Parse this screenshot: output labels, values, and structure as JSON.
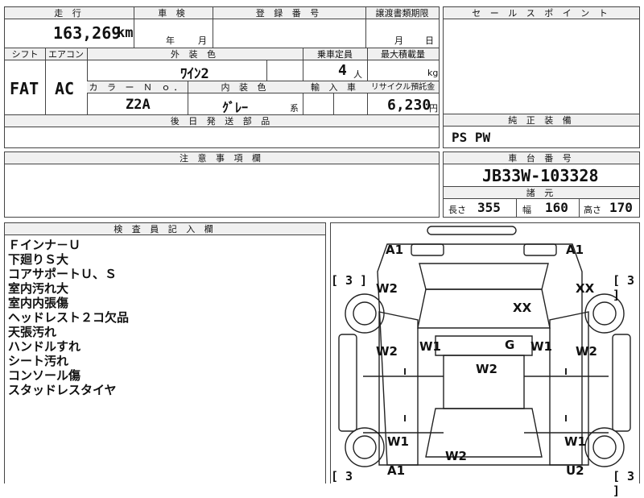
{
  "top": {
    "mileage_header": "走 行",
    "mileage_value": "163,269",
    "mileage_unit": "km",
    "inspection_header": "車 検",
    "inspection_year": "年",
    "inspection_month": "月",
    "reg_header": "登 録 番 号",
    "transfer_header": "譲渡書類期限",
    "transfer_month": "月",
    "transfer_day": "日"
  },
  "mid": {
    "shift_header": "シフト",
    "aircon_header": "エアコン",
    "ext_color_header": "外 装 色",
    "capacity_header": "乗車定員",
    "max_load_header": "最大積載量",
    "shift_value": "FAT",
    "aircon_value": "AC",
    "ext_color_value": "ﾜｲﾝ2",
    "capacity_value": "4",
    "capacity_unit": "人",
    "max_load_unit": "kg",
    "color_no_header": "カ ラ ー Ｎ ｏ．",
    "interior_header": "内 装 色",
    "import_header": "輸 入 車",
    "recycle_header": "リサイクル預託金",
    "color_no_value": "Z2A",
    "interior_value": "ｸﾞﾚｰ",
    "interior_suffix": "系",
    "recycle_value": "6,230",
    "recycle_unit": "円",
    "later_parts_header": "後 日 発 送 部 品"
  },
  "right": {
    "sales_header": "セ ー ル ス ポ イ ン ト",
    "equip_header": "純 正 装 備",
    "equip_value": "PS PW",
    "chassis_header": "車 台 番 号",
    "chassis_value": "JB33W-103328",
    "spec_header": "諸 元",
    "length_label": "長さ",
    "length_value": "355",
    "width_label": "幅",
    "width_value": "160",
    "height_label": "高さ",
    "height_value": "170"
  },
  "caution": {
    "header": "注 意 事 項 欄"
  },
  "inspector": {
    "header": "検 査 員 記 入 欄",
    "notes": [
      "Ｆインナ－Ｕ",
      "下廻りＳ大",
      "コアサポートＵ、Ｓ",
      "室内汚れ大",
      "室内内張傷",
      "ヘッドレスト２コ欠品",
      "天張汚れ",
      "ハンドルすれ",
      "シート汚れ",
      "コンソール傷",
      "スタッドレスタイヤ"
    ]
  },
  "diagram": {
    "marks": {
      "a1_front_left": "A1",
      "a1_front_right": "A1",
      "w2_left_fender": "W2",
      "xx_right_fender": "XX",
      "xx_hood": "XX",
      "w2_left_door_front": "W2",
      "w1_left_pillar": "W1",
      "g_glass": "G",
      "w1_right_pillar": "W1",
      "w2_right_door_front": "W2",
      "w2_roof": "W2",
      "w1_left_rear": "W1",
      "w1_right_rear": "W1",
      "w2_rear": "W2",
      "a1_rear_left": "A1",
      "u2_rear_right": "U2"
    },
    "tire_left_top": "[ 3 ]",
    "tire_right_top": "[ 3 ]",
    "tire_left_bottom": "[ 3",
    "tire_right_bottom": "[ 3 ]"
  }
}
